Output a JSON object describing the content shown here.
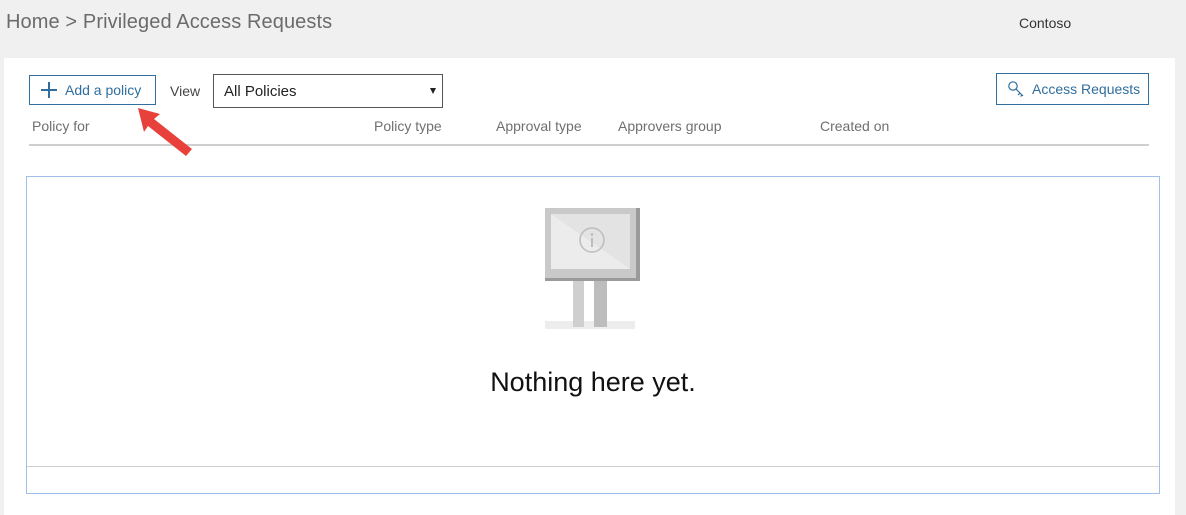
{
  "header": {
    "breadcrumb_home": "Home",
    "breadcrumb_sep": ">",
    "breadcrumb_current": "Privileged Access Requests",
    "tenant": "Contoso"
  },
  "toolbar": {
    "add_policy_label": "Add a policy",
    "view_label": "View",
    "view_select_value": "All Policies",
    "access_requests_label": "Access Requests"
  },
  "table": {
    "columns": [
      "Policy for",
      "Policy type",
      "Approval type",
      "Approvers group",
      "Created on"
    ]
  },
  "empty_state": {
    "message": "Nothing here yet."
  },
  "colors": {
    "accent": "#2f6e9e",
    "annotation_arrow": "#e8413b",
    "empty_border": "#9ec0ea"
  },
  "icons": {
    "add": "plus-icon",
    "access_requests": "key-search-icon",
    "select": "caret-down-icon",
    "empty": "info-kiosk-illustration"
  }
}
